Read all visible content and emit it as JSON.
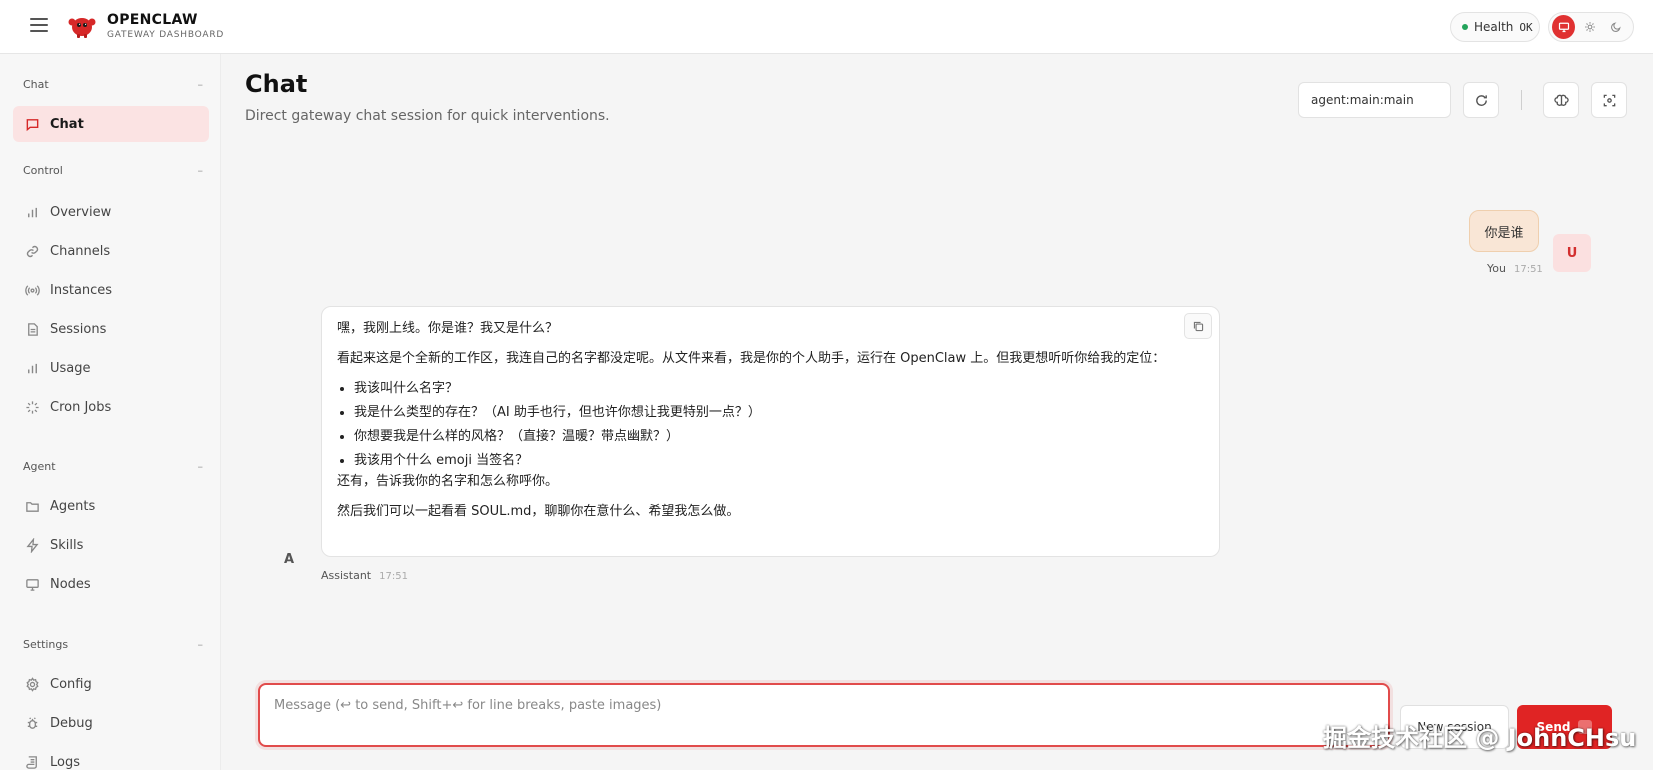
{
  "header": {
    "brand_title": "OPENCLAW",
    "brand_subtitle": "GATEWAY DASHBOARD",
    "health_label": "Health",
    "health_status": "OK",
    "health_color": "#22a35a",
    "accent_color": "#e02424",
    "theme_options": [
      "monitor-icon",
      "sun-icon",
      "moon-icon"
    ],
    "active_theme": "monitor-icon"
  },
  "sidebar": {
    "sections": [
      {
        "title": "Chat",
        "collapse": "–",
        "items": [
          {
            "label": "Chat",
            "icon": "message-square-icon",
            "active": true
          }
        ]
      },
      {
        "title": "Control",
        "collapse": "–",
        "items": [
          {
            "label": "Overview",
            "icon": "bar-chart-icon"
          },
          {
            "label": "Channels",
            "icon": "link-icon"
          },
          {
            "label": "Instances",
            "icon": "radio-icon"
          },
          {
            "label": "Sessions",
            "icon": "file-text-icon"
          },
          {
            "label": "Usage",
            "icon": "bar-chart-icon"
          },
          {
            "label": "Cron Jobs",
            "icon": "loader-icon"
          }
        ]
      },
      {
        "title": "Agent",
        "collapse": "–",
        "items": [
          {
            "label": "Agents",
            "icon": "folder-icon"
          },
          {
            "label": "Skills",
            "icon": "zap-icon"
          },
          {
            "label": "Nodes",
            "icon": "monitor-icon"
          }
        ]
      },
      {
        "title": "Settings",
        "collapse": "–",
        "items": [
          {
            "label": "Config",
            "icon": "gear-icon"
          },
          {
            "label": "Debug",
            "icon": "bug-icon"
          },
          {
            "label": "Logs",
            "icon": "scroll-icon"
          }
        ]
      }
    ]
  },
  "main": {
    "title": "Chat",
    "subtitle": "Direct gateway chat session for quick interventions.",
    "session_key": "agent:main:main"
  },
  "messages": {
    "user": {
      "text": "你是谁",
      "avatar": "U",
      "sender": "You",
      "time": "17:51"
    },
    "assistant": {
      "avatar": "A",
      "sender": "Assistant",
      "time": "17:51",
      "p1": "嘿，我刚上线。你是谁？我又是什么？",
      "p2": "看起来这是个全新的工作区，我连自己的名字都没定呢。从文件来看，我是你的个人助手，运行在 OpenClaw 上。但我更想听听你给我的定位：",
      "bullets": [
        "我该叫什么名字？",
        "我是什么类型的存在？（AI 助手也行，但也许你想让我更特别一点？）",
        "你想要我是什么样的风格？（直接？温暖？带点幽默？）",
        "我该用个什么 emoji 当签名？"
      ],
      "p3": "还有，告诉我你的名字和怎么称呼你。",
      "p4": "然后我们可以一起看看 SOUL.md，聊聊你在意什么、希望我怎么做。"
    }
  },
  "composer": {
    "placeholder": "Message (↩ to send, Shift+↩ for line breaks, paste images)",
    "new_session_label": "New session",
    "send_label": "Send"
  },
  "watermark": "掘金技术社区 @ JohnCHsu"
}
